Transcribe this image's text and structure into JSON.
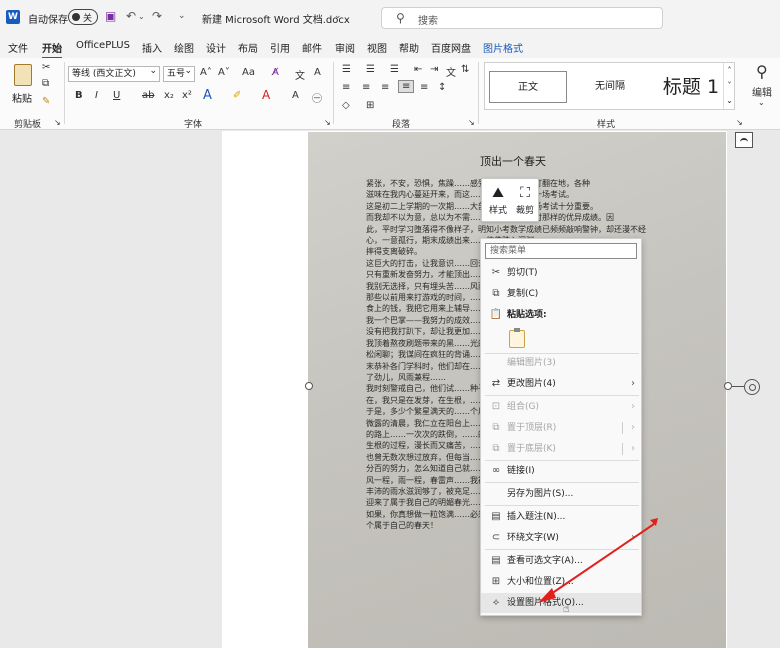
{
  "titlebar": {
    "autosave_label": "自动保存",
    "toggle_state": "关",
    "document_title": "新建 Microsoft Word 文档.docx",
    "search_placeholder": "搜索"
  },
  "menu": {
    "items": [
      "文件",
      "开始",
      "OfficePLUS",
      "插入",
      "绘图",
      "设计",
      "布局",
      "引用",
      "邮件",
      "审阅",
      "视图",
      "帮助",
      "百度网盘",
      "图片格式"
    ],
    "active": "开始"
  },
  "ribbon": {
    "clipboard": {
      "paste_label": "粘贴",
      "group_label": "剪贴板"
    },
    "font": {
      "font_name": "等线 (西文正文)",
      "font_size": "五号",
      "group_label": "字体"
    },
    "paragraph": {
      "group_label": "段落"
    },
    "styles": {
      "items": [
        "正文",
        "无间隔",
        "标题 1"
      ],
      "group_label": "样式"
    },
    "editing": {
      "label": "编辑"
    }
  },
  "document": {
    "title": "顶出一个春天",
    "paragraph_text": "紧张，不安，恐惧，焦躁……感受如同五味瓶被打翻在地，各种\n滋味在我内心蔓延开来，而这……开这严冬里的一场考试。\n这是初二上学期的一次期……大部分人来说，这场考试十分重要。\n而我却不以为意，总以为不需……应对得像初一时那样的优异成绩。因\n此，平时学习堕落得不像样子，明知小考数学成绩已频频敲响警钟，却还漫不经\n心，一意孤行，期末成绩出来……仿佛跌入深渊，\n摔得支离破碎。\n这巨大的打击，让我意识……回去，我\n只有重新发奋努力，才能顶出……\n我别无选择，只有埋头苦……风雨，\n那些以前用来打游戏的时间，……衣服鞋子零\n食上的钱，我把它用来上辅导……知识的浪地给了\n我一个巴掌——我努力的成效……这一掌\n没有把我打趴下，却让我更加……\n我顶着熬夜刷题带来的黑……光的土地\n松闲聊；我谋间在疯狂的背诵……我在全；我周\n末恭补各门学科时，他们却在……日子却想起\n了劲儿，风雨兼程……\n我时刻警戒自己，他们试……种子，现\n在，我只是在发芽，在生根，……\n于是，多少个繁星满天的……个晨曦\n微露的清晨，我仁立在阳台上……去补习\n的路上……一次次的跌倒，……的跌倒，\n生根的过程，漫长而又痛苦，……松自己，\n也曾无数次想过放弃，但每当……不作出百\n分百的努力，怎么知道自己就……\n风一程，雨一程，春雷声……我被\n丰沛的雨水滋润够了，被充足……上而出，\n迎来了属于我自己的明媚春光……\n如果，你真想做一粒饱满……必须出一\n个属于自己的春天！"
  },
  "mini_toolbar": {
    "style_label": "样式",
    "crop_label": "裁剪"
  },
  "context_menu": {
    "search_placeholder": "搜索菜单",
    "cut": "剪切(T)",
    "copy": "复制(C)",
    "paste_options": "粘贴选项:",
    "edit_picture": "编辑图片(3)",
    "change_picture": "更改图片(4)",
    "group": "组合(G)",
    "bring_front": "置于顶层(R)",
    "send_back": "置于底层(K)",
    "link": "链接(I)",
    "save_as_picture": "另存为图片(S)...",
    "insert_caption": "插入题注(N)...",
    "wrap_text": "环绕文字(W)",
    "alt_text": "查看可选文字(A)...",
    "size_position": "大小和位置(Z)...",
    "format_picture": "设置图片格式(O)..."
  },
  "colors": {
    "accent": "#185abd",
    "arrow": "#e0201c"
  }
}
